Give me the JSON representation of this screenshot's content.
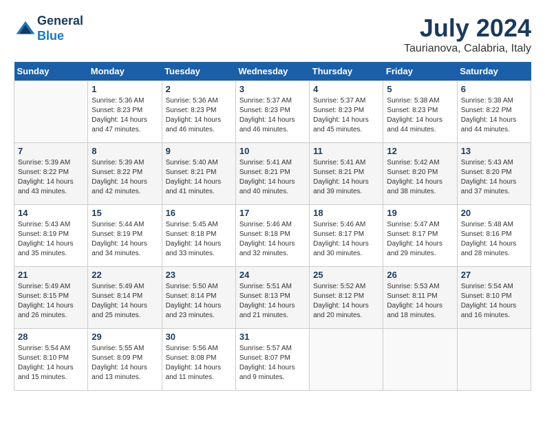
{
  "header": {
    "logo_line1": "General",
    "logo_line2": "Blue",
    "month_title": "July 2024",
    "location": "Taurianova, Calabria, Italy"
  },
  "days_of_week": [
    "Sunday",
    "Monday",
    "Tuesday",
    "Wednesday",
    "Thursday",
    "Friday",
    "Saturday"
  ],
  "weeks": [
    [
      {
        "day": "",
        "empty": true
      },
      {
        "day": "1",
        "sunrise": "Sunrise: 5:36 AM",
        "sunset": "Sunset: 8:23 PM",
        "daylight": "Daylight: 14 hours and 47 minutes."
      },
      {
        "day": "2",
        "sunrise": "Sunrise: 5:36 AM",
        "sunset": "Sunset: 8:23 PM",
        "daylight": "Daylight: 14 hours and 46 minutes."
      },
      {
        "day": "3",
        "sunrise": "Sunrise: 5:37 AM",
        "sunset": "Sunset: 8:23 PM",
        "daylight": "Daylight: 14 hours and 46 minutes."
      },
      {
        "day": "4",
        "sunrise": "Sunrise: 5:37 AM",
        "sunset": "Sunset: 8:23 PM",
        "daylight": "Daylight: 14 hours and 45 minutes."
      },
      {
        "day": "5",
        "sunrise": "Sunrise: 5:38 AM",
        "sunset": "Sunset: 8:23 PM",
        "daylight": "Daylight: 14 hours and 44 minutes."
      },
      {
        "day": "6",
        "sunrise": "Sunrise: 5:38 AM",
        "sunset": "Sunset: 8:22 PM",
        "daylight": "Daylight: 14 hours and 44 minutes."
      }
    ],
    [
      {
        "day": "7",
        "sunrise": "Sunrise: 5:39 AM",
        "sunset": "Sunset: 8:22 PM",
        "daylight": "Daylight: 14 hours and 43 minutes."
      },
      {
        "day": "8",
        "sunrise": "Sunrise: 5:39 AM",
        "sunset": "Sunset: 8:22 PM",
        "daylight": "Daylight: 14 hours and 42 minutes."
      },
      {
        "day": "9",
        "sunrise": "Sunrise: 5:40 AM",
        "sunset": "Sunset: 8:21 PM",
        "daylight": "Daylight: 14 hours and 41 minutes."
      },
      {
        "day": "10",
        "sunrise": "Sunrise: 5:41 AM",
        "sunset": "Sunset: 8:21 PM",
        "daylight": "Daylight: 14 hours and 40 minutes."
      },
      {
        "day": "11",
        "sunrise": "Sunrise: 5:41 AM",
        "sunset": "Sunset: 8:21 PM",
        "daylight": "Daylight: 14 hours and 39 minutes."
      },
      {
        "day": "12",
        "sunrise": "Sunrise: 5:42 AM",
        "sunset": "Sunset: 8:20 PM",
        "daylight": "Daylight: 14 hours and 38 minutes."
      },
      {
        "day": "13",
        "sunrise": "Sunrise: 5:43 AM",
        "sunset": "Sunset: 8:20 PM",
        "daylight": "Daylight: 14 hours and 37 minutes."
      }
    ],
    [
      {
        "day": "14",
        "sunrise": "Sunrise: 5:43 AM",
        "sunset": "Sunset: 8:19 PM",
        "daylight": "Daylight: 14 hours and 35 minutes."
      },
      {
        "day": "15",
        "sunrise": "Sunrise: 5:44 AM",
        "sunset": "Sunset: 8:19 PM",
        "daylight": "Daylight: 14 hours and 34 minutes."
      },
      {
        "day": "16",
        "sunrise": "Sunrise: 5:45 AM",
        "sunset": "Sunset: 8:18 PM",
        "daylight": "Daylight: 14 hours and 33 minutes."
      },
      {
        "day": "17",
        "sunrise": "Sunrise: 5:46 AM",
        "sunset": "Sunset: 8:18 PM",
        "daylight": "Daylight: 14 hours and 32 minutes."
      },
      {
        "day": "18",
        "sunrise": "Sunrise: 5:46 AM",
        "sunset": "Sunset: 8:17 PM",
        "daylight": "Daylight: 14 hours and 30 minutes."
      },
      {
        "day": "19",
        "sunrise": "Sunrise: 5:47 AM",
        "sunset": "Sunset: 8:17 PM",
        "daylight": "Daylight: 14 hours and 29 minutes."
      },
      {
        "day": "20",
        "sunrise": "Sunrise: 5:48 AM",
        "sunset": "Sunset: 8:16 PM",
        "daylight": "Daylight: 14 hours and 28 minutes."
      }
    ],
    [
      {
        "day": "21",
        "sunrise": "Sunrise: 5:49 AM",
        "sunset": "Sunset: 8:15 PM",
        "daylight": "Daylight: 14 hours and 26 minutes."
      },
      {
        "day": "22",
        "sunrise": "Sunrise: 5:49 AM",
        "sunset": "Sunset: 8:14 PM",
        "daylight": "Daylight: 14 hours and 25 minutes."
      },
      {
        "day": "23",
        "sunrise": "Sunrise: 5:50 AM",
        "sunset": "Sunset: 8:14 PM",
        "daylight": "Daylight: 14 hours and 23 minutes."
      },
      {
        "day": "24",
        "sunrise": "Sunrise: 5:51 AM",
        "sunset": "Sunset: 8:13 PM",
        "daylight": "Daylight: 14 hours and 21 minutes."
      },
      {
        "day": "25",
        "sunrise": "Sunrise: 5:52 AM",
        "sunset": "Sunset: 8:12 PM",
        "daylight": "Daylight: 14 hours and 20 minutes."
      },
      {
        "day": "26",
        "sunrise": "Sunrise: 5:53 AM",
        "sunset": "Sunset: 8:11 PM",
        "daylight": "Daylight: 14 hours and 18 minutes."
      },
      {
        "day": "27",
        "sunrise": "Sunrise: 5:54 AM",
        "sunset": "Sunset: 8:10 PM",
        "daylight": "Daylight: 14 hours and 16 minutes."
      }
    ],
    [
      {
        "day": "28",
        "sunrise": "Sunrise: 5:54 AM",
        "sunset": "Sunset: 8:10 PM",
        "daylight": "Daylight: 14 hours and 15 minutes."
      },
      {
        "day": "29",
        "sunrise": "Sunrise: 5:55 AM",
        "sunset": "Sunset: 8:09 PM",
        "daylight": "Daylight: 14 hours and 13 minutes."
      },
      {
        "day": "30",
        "sunrise": "Sunrise: 5:56 AM",
        "sunset": "Sunset: 8:08 PM",
        "daylight": "Daylight: 14 hours and 11 minutes."
      },
      {
        "day": "31",
        "sunrise": "Sunrise: 5:57 AM",
        "sunset": "Sunset: 8:07 PM",
        "daylight": "Daylight: 14 hours and 9 minutes."
      },
      {
        "day": "",
        "empty": true
      },
      {
        "day": "",
        "empty": true
      },
      {
        "day": "",
        "empty": true
      }
    ]
  ]
}
